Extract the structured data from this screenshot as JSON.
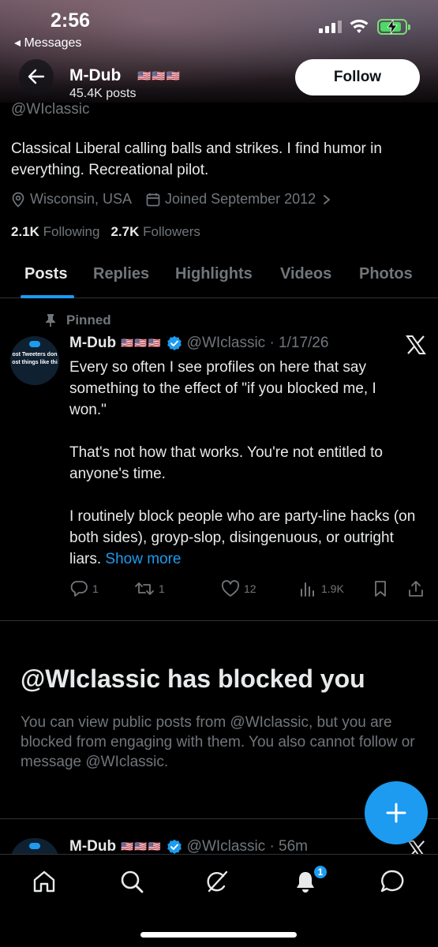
{
  "status_bar": {
    "time": "2:56",
    "back_app": "◂ Messages"
  },
  "header": {
    "name": "M-Dub",
    "flags": "🇺🇸🇺🇸🇺🇸",
    "posts_count": "45.4K posts",
    "follow_label": "Follow"
  },
  "profile": {
    "handle": "@WIclassic",
    "bio": "Classical Liberal calling balls and strikes. I find humor in everything. Recreational pilot.",
    "location": "Wisconsin, USA",
    "joined": "Joined September 2012",
    "following_count": "2.1K",
    "following_label": "Following",
    "followers_count": "2.7K",
    "followers_label": "Followers"
  },
  "tabs": [
    {
      "label": "Posts"
    },
    {
      "label": "Replies"
    },
    {
      "label": "Highlights"
    },
    {
      "label": "Videos"
    },
    {
      "label": "Photos"
    }
  ],
  "pinned_tweet": {
    "pinned_label": "Pinned",
    "avatar_text": [
      "ost Tweeters don",
      "ost things like thi"
    ],
    "name": "M-Dub",
    "flags": "🇺🇸🇺🇸🇺🇸",
    "handle_date": "@WIclassic · 1/17/26",
    "paragraphs": [
      "Every so often I see profiles on here that say something to the effect of \"if you blocked me, I won.\"",
      "That's not how that works. You're not entitled to anyone's time.",
      "I routinely block people who are party-line hacks (on both sides), groyp-slop, disingenuous, or outright liars."
    ],
    "show_more": "Show more",
    "replies": "1",
    "reposts": "1",
    "likes": "12",
    "views": "1.9K"
  },
  "blocked": {
    "title": "@WIclassic has blocked you",
    "description": "You can view public posts from @WIclassic, but you are blocked from engaging with them. You also cannot follow or message @WIclassic."
  },
  "second_tweet": {
    "name": "M-Dub",
    "flags": "🇺🇸🇺🇸🇺🇸",
    "handle_date": "@WIclassic · 56m"
  },
  "nav": {
    "notification_count": "1"
  },
  "colors": {
    "accent": "#1d9bf0",
    "muted": "#71767b",
    "text": "#e7e9ea",
    "background": "#000000"
  },
  "icons": [
    "back-arrow-icon",
    "location-icon",
    "calendar-icon",
    "chevron-right-icon",
    "pin-icon",
    "verified-icon",
    "x-logo-icon",
    "reply-icon",
    "repost-icon",
    "like-icon",
    "views-icon",
    "bookmark-icon",
    "share-icon",
    "plus-icon",
    "home-icon",
    "search-icon",
    "grok-icon",
    "bell-icon",
    "messages-icon"
  ]
}
